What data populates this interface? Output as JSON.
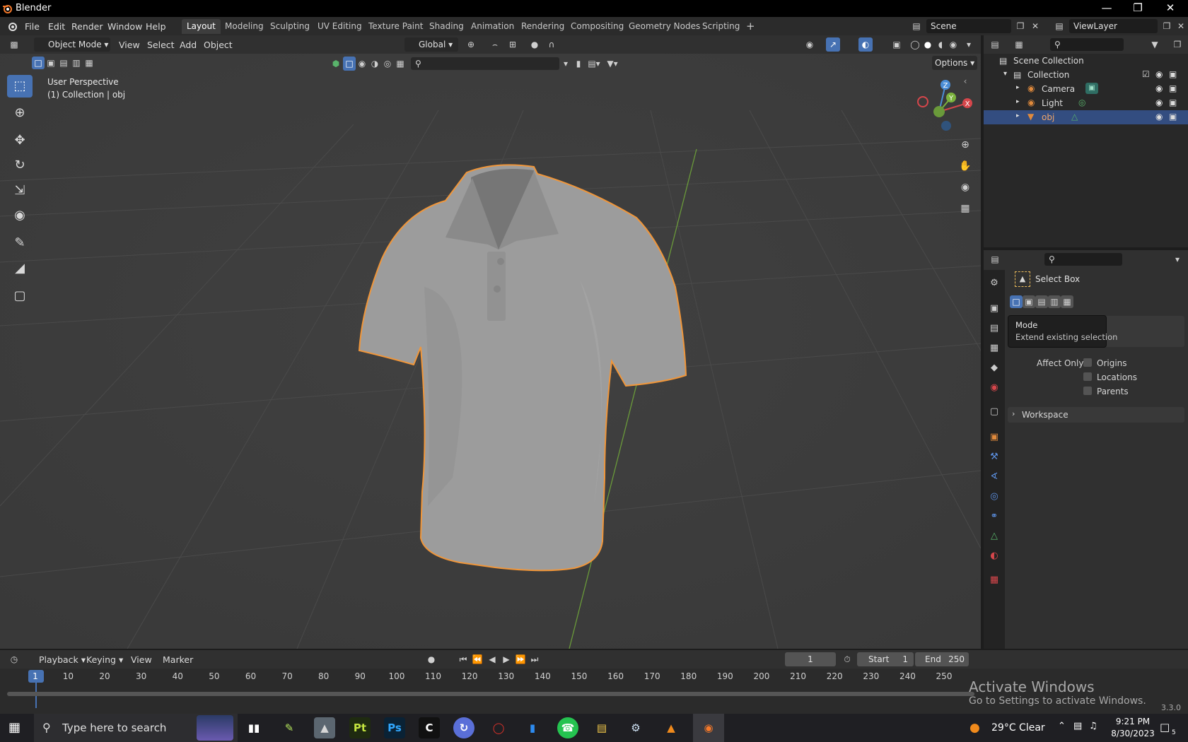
{
  "window": {
    "title": "Blender"
  },
  "menu": {
    "items": [
      "File",
      "Edit",
      "Render",
      "Window",
      "Help"
    ]
  },
  "workspaces": [
    "Layout",
    "Modeling",
    "Sculpting",
    "UV Editing",
    "Texture Paint",
    "Shading",
    "Animation",
    "Rendering",
    "Compositing",
    "Geometry Nodes",
    "Scripting"
  ],
  "active_workspace": "Layout",
  "scene": {
    "name": "Scene",
    "view_layer": "ViewLayer"
  },
  "viewport": {
    "mode": "Object Mode",
    "menus": [
      "View",
      "Select",
      "Add",
      "Object"
    ],
    "transform_orientation": "Global",
    "options_label": "Options",
    "overlay_line1": "User Perspective",
    "overlay_line2": "(1) Collection | obj",
    "gizmo_axes": {
      "z": "Z",
      "y": "Y",
      "x": "X"
    },
    "accent": "#4772b3",
    "selection_outline": "#f0963a"
  },
  "outliner": {
    "root": "Scene Collection",
    "collection": "Collection",
    "items": [
      {
        "name": "Camera",
        "icon": "camera-icon"
      },
      {
        "name": "Light",
        "icon": "light-icon"
      },
      {
        "name": "obj",
        "icon": "mesh-icon",
        "selected": true
      }
    ]
  },
  "properties": {
    "tool_name": "Select Box",
    "tooltip_title": "Mode",
    "tooltip_body": "Extend existing selection",
    "affect_only_label": "Affect Only",
    "affect_only_options": [
      "Origins",
      "Locations",
      "Parents"
    ],
    "workspace_panel": "Workspace"
  },
  "timeline": {
    "menus": [
      "Playback",
      "Keying",
      "View",
      "Marker"
    ],
    "current_frame": "1",
    "start_label": "Start",
    "start_value": "1",
    "end_label": "End",
    "end_value": "250",
    "ticks": [
      "1",
      "10",
      "20",
      "30",
      "40",
      "50",
      "60",
      "70",
      "80",
      "90",
      "100",
      "110",
      "120",
      "130",
      "140",
      "150",
      "160",
      "170",
      "180",
      "190",
      "200",
      "210",
      "220",
      "230",
      "240",
      "250"
    ]
  },
  "status": {
    "version": "3.3.0"
  },
  "activation": {
    "line1": "Activate Windows",
    "line2": "Go to Settings to activate Windows."
  },
  "taskbar": {
    "search_placeholder": "Type here to search",
    "weather": "29°C  Clear",
    "time": "9:21 PM",
    "date": "8/30/2023",
    "notification_count": "5"
  }
}
